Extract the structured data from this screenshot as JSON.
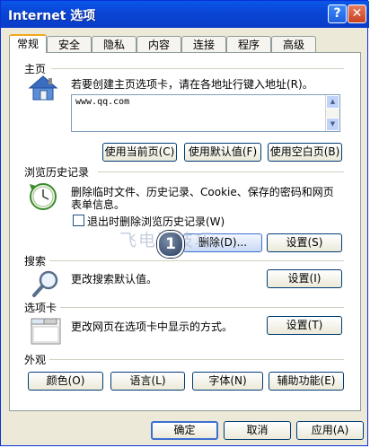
{
  "window": {
    "title": "Internet 选项"
  },
  "title_buttons": {
    "help": "?",
    "close": "✕"
  },
  "tabs": [
    {
      "label": "常规",
      "active": true
    },
    {
      "label": "安全"
    },
    {
      "label": "隐私"
    },
    {
      "label": "内容"
    },
    {
      "label": "连接"
    },
    {
      "label": "程序"
    },
    {
      "label": "高级"
    }
  ],
  "home": {
    "group_title": "主页",
    "description": "若要创建主页选项卡，请在各地址行键入地址(R)。",
    "url": "www.qq.com",
    "use_current": "使用当前页(C)",
    "use_default": "使用默认值(F)",
    "use_blank": "使用空白页(B)"
  },
  "history": {
    "group_title": "浏览历史记录",
    "description_line1": "删除临时文件、历史记录、Cookie、保存的密码和网页",
    "description_line2": "表单信息。",
    "checkbox_label": "退出时删除浏览历史记录(W)",
    "checkbox_checked": false,
    "delete_button": "删除(D)...",
    "settings_button": "设置(S)"
  },
  "search": {
    "group_title": "搜索",
    "description": "更改搜索默认值。",
    "settings_button": "设置(I)"
  },
  "tabs_group": {
    "group_title": "选项卡",
    "description": "更改网页在选项卡中显示的方式。",
    "settings_button": "设置(T)"
  },
  "appearance": {
    "group_title": "外观",
    "colors": "颜色(O)",
    "languages": "语言(L)",
    "fonts": "字体(N)",
    "accessibility": "辅助功能(E)"
  },
  "footer": {
    "ok": "确定",
    "cancel": "取消",
    "apply": "应用(A)"
  },
  "overlay": {
    "step_badge": "1",
    "watermark": "飞电脑技巧"
  },
  "colors": {
    "titlebar": "#0a46d6",
    "window_bg": "#ece9d8",
    "active_tab_accent": "#f3a81e",
    "button_border": "#003c74"
  }
}
